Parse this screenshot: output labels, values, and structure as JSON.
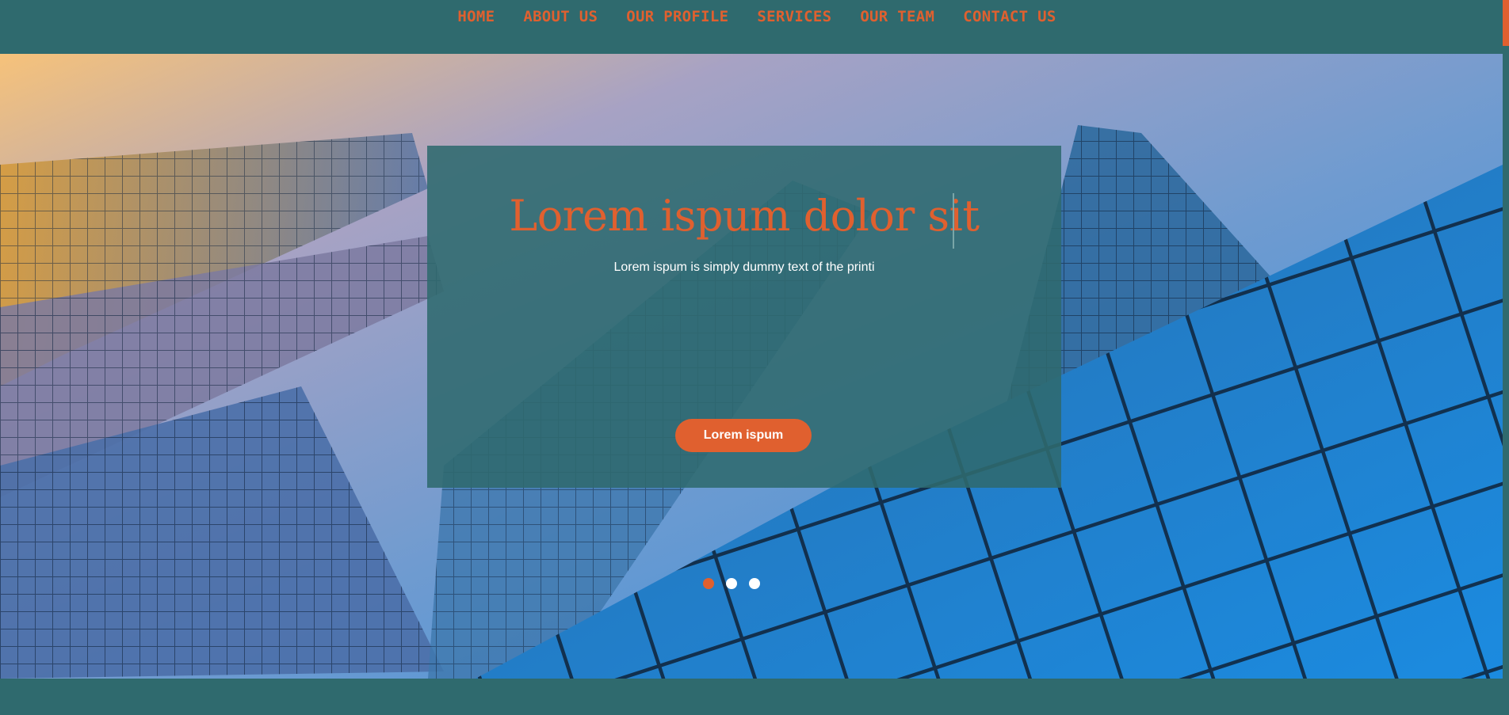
{
  "nav": {
    "items": [
      "HOME",
      "ABOUT US",
      "OUR PROFILE",
      "SERVICES",
      "OUR TEAM",
      "CONTACT US"
    ]
  },
  "hero": {
    "title": "Lorem ispum dolor sit",
    "subtitle": "Lorem ispum is simply dummy text of the printi",
    "button_label": "Lorem ispum",
    "slide_count": 3,
    "active_slide": 1
  },
  "colors": {
    "accent": "#e0602f",
    "nav_background": "#2f6a6e",
    "caption_overlay": "#2f6a6e"
  }
}
